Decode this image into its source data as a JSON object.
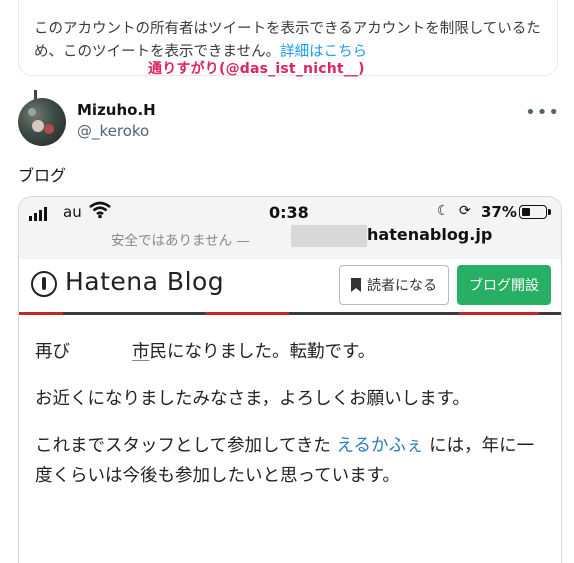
{
  "quoted": {
    "restricted_text": "このアカウントの所有者はツイートを表示できるアカウントを制限しているため、このツイートを表示できません。",
    "details_link": "詳細はこちら"
  },
  "attribution": "通りすがり(@das_ist_nicht__)",
  "tweet": {
    "display_name": "Mizuho.H",
    "handle": "@_keroko",
    "more_icon": "more-horizontal-icon",
    "text": "ブログ"
  },
  "screenshot": {
    "status_bar": {
      "carrier": "au",
      "time": "0:38",
      "battery": "37%",
      "battery_level": 0.37
    },
    "url_bar": {
      "insecure_label": "安全ではありません —",
      "domain": "hatenablog.jp"
    },
    "header": {
      "logo": "Hatena Blog",
      "reader_button": "読者になる",
      "open_blog_button": "ブログ開設"
    },
    "body": {
      "p1_a": "再び",
      "p1_b": "市",
      "p1_c": "民になりました。転勤です。",
      "p2": "お近くになりましたみなさま，よろしくお願いします。",
      "p3_a": "これまでスタッフとして参加してきた",
      "p3_link": "えるかふぇ",
      "p3_b": "には，年に一度くらいは今後も参加したいと思っています。"
    }
  }
}
